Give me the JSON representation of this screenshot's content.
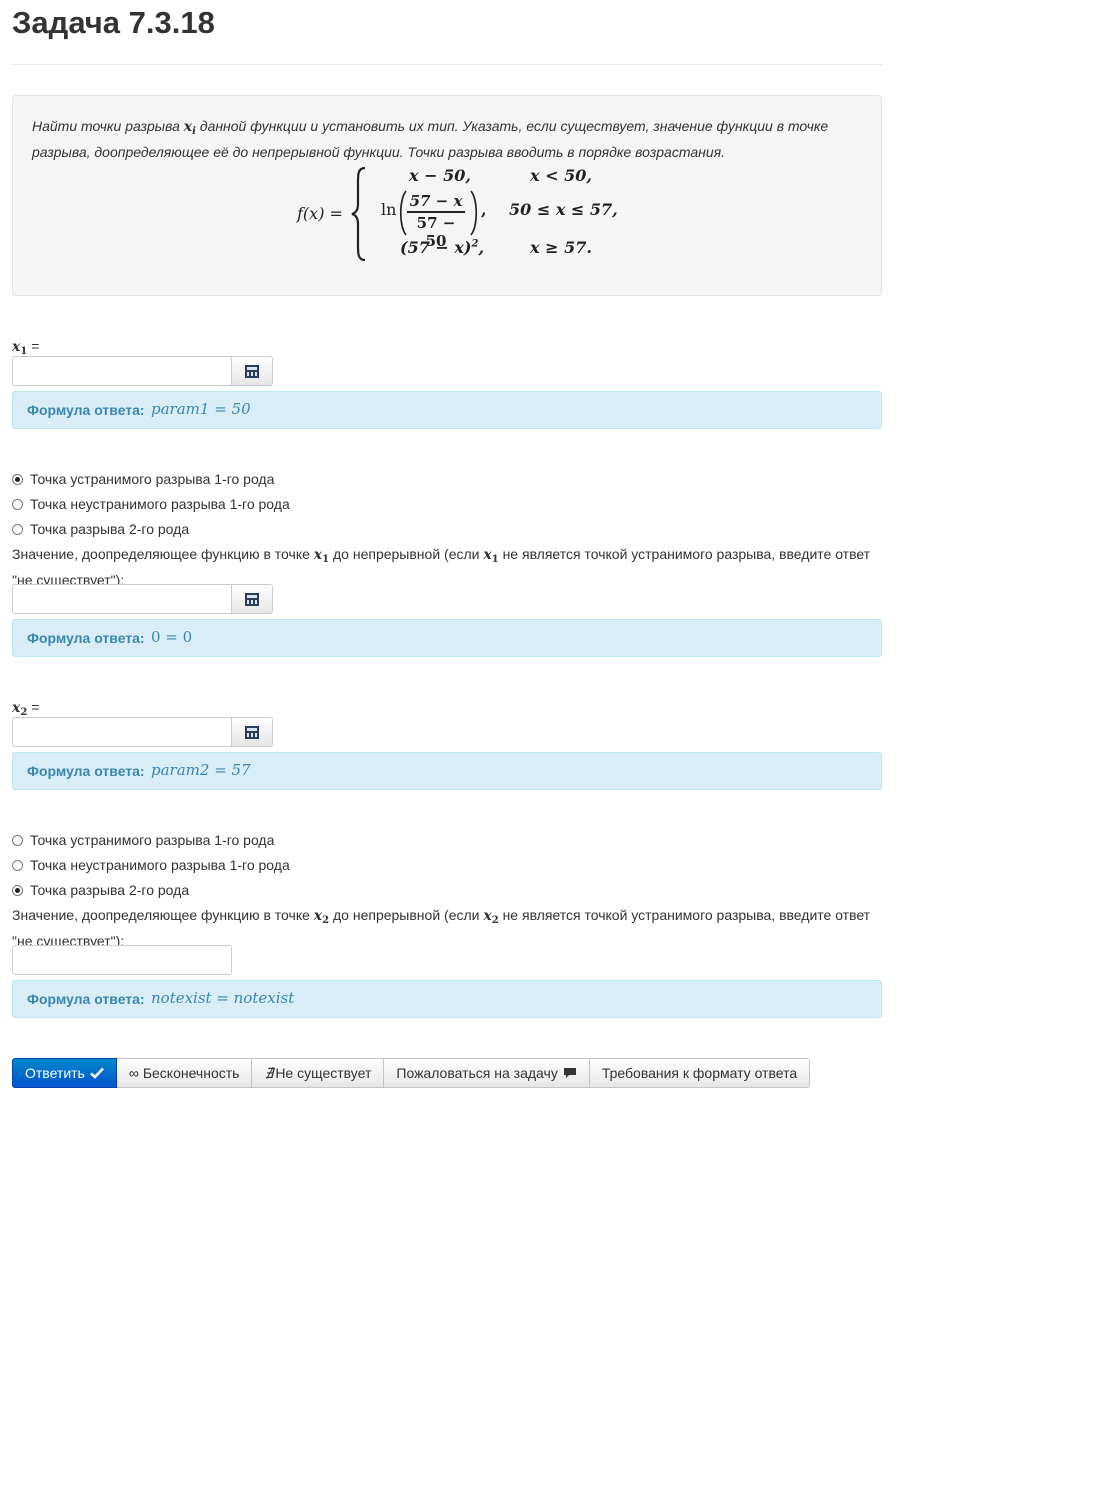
{
  "page": {
    "title": "Задача 7.3.18"
  },
  "task": {
    "text_1": "Найти точки разрыва ",
    "var_x": "x",
    "var_i": "i",
    "text_2": " данной функции и установить их тип. Указать, если существует, значение функции в точке разрыва, доопределяющее её до непрерывной функции. Точки разрыва вводить в порядке возрастания."
  },
  "formula": {
    "lhs": "f(x) =",
    "row1_expr": "x − 50,",
    "row1_cond": "x < 50,",
    "ln": "ln",
    "frac_num": "57 − x",
    "frac_den": "57 − 50",
    "row2_cond": "50 ≤ x ≤ 57,",
    "row3_expr": "(57 − x)",
    "row3_exp": "2",
    "row3_comma": ",",
    "row3_cond": "x ≥ 57."
  },
  "point1": {
    "label_var": "x",
    "label_sub": "1",
    "label_eq": " =",
    "input_value": "",
    "answer_label": "Формула ответа:",
    "answer_value": "param1 = 50",
    "options": [
      "Точка устранимого разрыва 1-го рода",
      "Точка неустранимого разрыва 1-го рода",
      "Точка разрыва 2-го рода"
    ],
    "selected_option": 0,
    "note_1": "Значение, доопределяющее функцию в точке ",
    "note_var": "x",
    "note_sub": "1",
    "note_2": " до непрерывной (если ",
    "note_3": " не является точкой устранимого разрыва, введите ответ \"не существует\"):",
    "value_input": "",
    "value_answer_label": "Формула ответа:",
    "value_answer_value": "0 = 0"
  },
  "point2": {
    "label_var": "x",
    "label_sub": "2",
    "label_eq": " =",
    "input_value": "",
    "answer_label": "Формула ответа:",
    "answer_value": "param2 = 57",
    "options": [
      "Точка устранимого разрыва 1-го рода",
      "Точка неустранимого разрыва 1-го рода",
      "Точка разрыва 2-го рода"
    ],
    "selected_option": 2,
    "note_1": "Значение, доопределяющее функцию в точке ",
    "note_var": "x",
    "note_sub": "2",
    "note_2": " до непрерывной (если ",
    "note_3": " не является точкой устранимого разрыва, введите ответ \"не существует\"):",
    "value_input": "",
    "value_answer_label": "Формула ответа:",
    "value_answer_value": "notexist = notexist"
  },
  "toolbar": {
    "submit": "Ответить",
    "infinity_symbol": "∞",
    "infinity": "Бесконечность",
    "not_exists_symbol": "∄",
    "not_exists": "Не существует",
    "report": "Пожаловаться на задачу",
    "format": "Требования к формату ответа"
  },
  "icons": {
    "calculator": "calculator-icon",
    "check": "check-icon",
    "comment": "comment-icon"
  },
  "colors": {
    "primary": "#0066cc",
    "alert_bg": "#d9edf7",
    "alert_text": "#3a87ad"
  }
}
